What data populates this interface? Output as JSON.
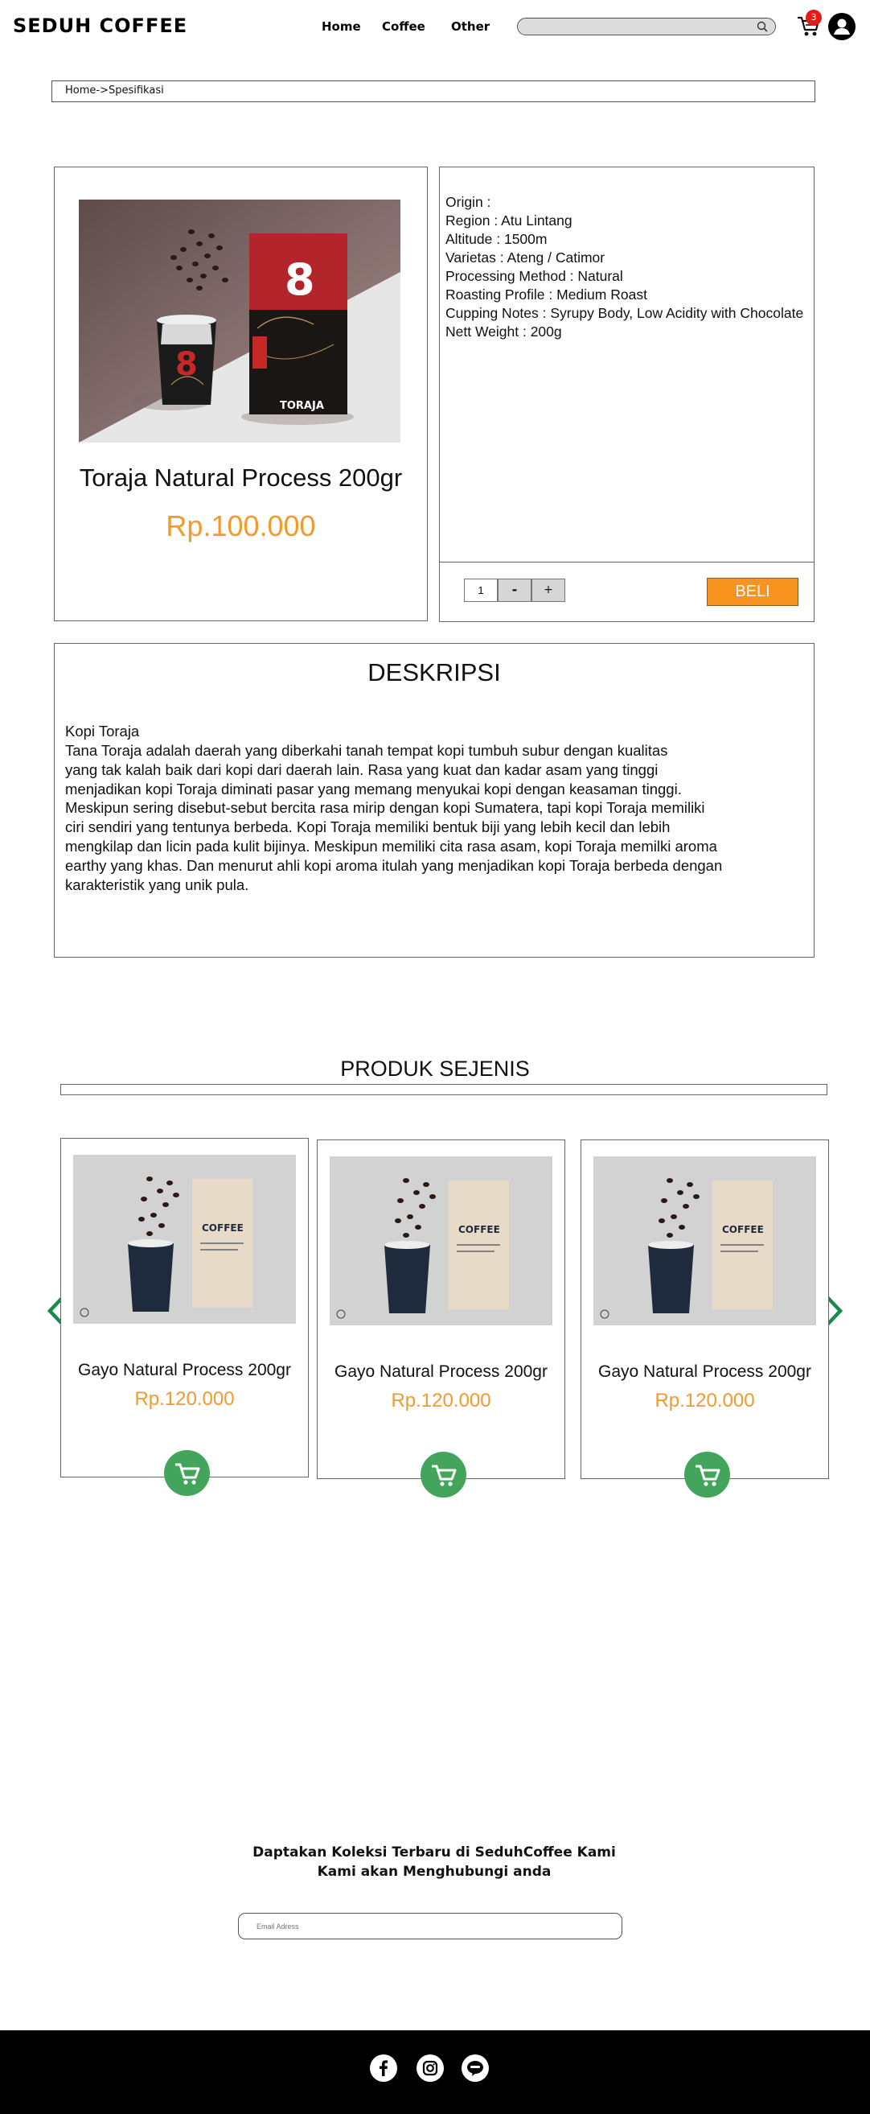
{
  "header": {
    "brand": "SEDUH COFFEE",
    "nav": [
      "Home",
      "Coffee",
      "Other"
    ],
    "search_placeholder": "",
    "cart_count": "3",
    "icons": [
      "search-icon",
      "cart-icon",
      "user-icon"
    ]
  },
  "breadcrumb": "Home->Spesifikasi",
  "product": {
    "name": "Toraja Natural Process 200gr",
    "price": "Rp.100.000",
    "specs": [
      "Origin :",
      "Region : Atu Lintang",
      "Altitude : 1500m",
      "Varietas : Ateng / Catimor",
      "Processing Method : Natural",
      "Roasting Profile : Medium Roast",
      "Cupping Notes : Syrupy Body, Low Acidity with Chocolate",
      "Nett Weight : 200g"
    ],
    "quantity": "1",
    "minus_label": "-",
    "plus_label": "+",
    "buy_label": "BELI",
    "package_brand_number": "8",
    "package_label": "TORAJA"
  },
  "description": {
    "title": "DESKRIPSI",
    "subtitle": "Kopi Toraja",
    "body": "Tana Toraja adalah daerah yang diberkahi tanah tempat kopi tumbuh subur dengan kualitas\nyang tak kalah baik dari kopi dari daerah lain. Rasa yang kuat dan kadar asam yang tinggi\nmenjadikan kopi Toraja diminati pasar yang memang menyukai kopi dengan keasaman tinggi.\nMeskipun sering disebut-sebut bercita rasa mirip dengan kopi Sumatera, tapi kopi Toraja memiliki\nciri sendiri yang tentunya berbeda. Kopi Toraja memiliki bentuk biji yang lebih kecil dan lebih\nmengkilap dan licin pada kulit bijinya. Meskipun memiliki cita rasa asam, kopi Toraja memilki aroma\nearthy yang khas. Dan menurut ahli kopi aroma itulah yang menjadikan kopi Toraja berbeda dengan\nkarakteristik yang unik pula."
  },
  "related": {
    "title": "PRODUK SEJENIS",
    "items": [
      {
        "name": "Gayo Natural Process 200gr",
        "price": "Rp.120.000",
        "bag_label": "COFFEE"
      },
      {
        "name": "Gayo Natural Process 200gr",
        "price": "Rp.120.000",
        "bag_label": "COFFEE"
      },
      {
        "name": "Gayo Natural Process 200gr",
        "price": "Rp.120.000",
        "bag_label": "COFFEE"
      }
    ]
  },
  "newsletter": {
    "line1": "Daptakan Koleksi Terbaru  di SeduhCoffee Kami",
    "line2": "Kami akan Menghubungi anda",
    "email_placeholder": "Email Adress"
  },
  "footer": {
    "social": [
      "facebook-icon",
      "instagram-icon",
      "line-icon"
    ]
  },
  "colors": {
    "price": "#f29a2e",
    "buy_button": "#f7931e",
    "cart_button": "#42a55b",
    "arrow": "#1a8a4a",
    "badge": "#e21b1b",
    "footer": "#000000"
  }
}
